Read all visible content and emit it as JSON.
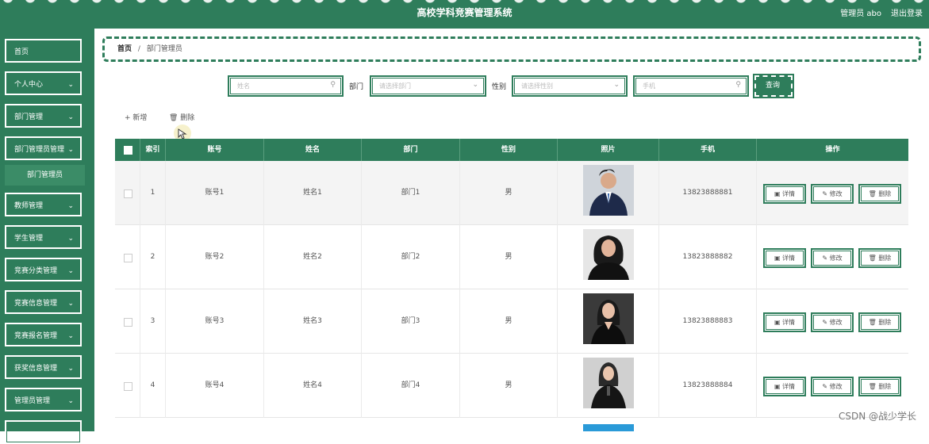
{
  "header": {
    "title": "高校学科竞赛管理系统",
    "user": "管理员 abo",
    "logout": "退出登录"
  },
  "sidebar": {
    "items": [
      {
        "label": "首页",
        "chev": ""
      },
      {
        "label": "个人中心",
        "chev": "⌄"
      },
      {
        "label": "部门管理",
        "chev": "⌄"
      },
      {
        "label": "部门管理员管理",
        "chev": "⌄"
      },
      {
        "label": "部门管理员",
        "chev": ""
      },
      {
        "label": "教师管理",
        "chev": "⌄"
      },
      {
        "label": "学生管理",
        "chev": "⌄"
      },
      {
        "label": "竞赛分类管理",
        "chev": "⌄"
      },
      {
        "label": "竞赛信息管理",
        "chev": "⌄"
      },
      {
        "label": "竞赛报名管理",
        "chev": "⌄"
      },
      {
        "label": "获奖信息管理",
        "chev": "⌄"
      },
      {
        "label": "管理员管理",
        "chev": "⌄"
      },
      {
        "label": "",
        "chev": ""
      }
    ]
  },
  "breadcrumb": {
    "home": "首页",
    "sep": "/",
    "current": "部门管理员"
  },
  "search": {
    "name_placeholder": "姓名",
    "dept_label": "部门",
    "dept_placeholder": "请选择部门",
    "gender_label": "性别",
    "gender_placeholder": "请选择性别",
    "phone_placeholder": "手机",
    "search_button": "查询",
    "icons": {
      "search": "search-icon",
      "dropdown": "chevron-down-icon"
    }
  },
  "actions": {
    "add": "+ 新增",
    "delete": "🗑 删除"
  },
  "table": {
    "headers": [
      "索引",
      "账号",
      "姓名",
      "部门",
      "性别",
      "照片",
      "手机",
      "操作"
    ],
    "rows": [
      {
        "index": "1",
        "account": "账号1",
        "name": "姓名1",
        "dept": "部门1",
        "gender": "男",
        "phone": "13823888881"
      },
      {
        "index": "2",
        "account": "账号2",
        "name": "姓名2",
        "dept": "部门2",
        "gender": "男",
        "phone": "13823888882"
      },
      {
        "index": "3",
        "account": "账号3",
        "name": "姓名3",
        "dept": "部门3",
        "gender": "男",
        "phone": "13823888883"
      },
      {
        "index": "4",
        "account": "账号4",
        "name": "姓名4",
        "dept": "部门4",
        "gender": "男",
        "phone": "13823888884"
      }
    ],
    "op_labels": {
      "detail": "▣ 详情",
      "edit": "✎ 修改",
      "delete": "🗑 删除"
    }
  },
  "watermark": "CSDN @战少学长",
  "colors": {
    "primary": "#2e7d5b"
  }
}
